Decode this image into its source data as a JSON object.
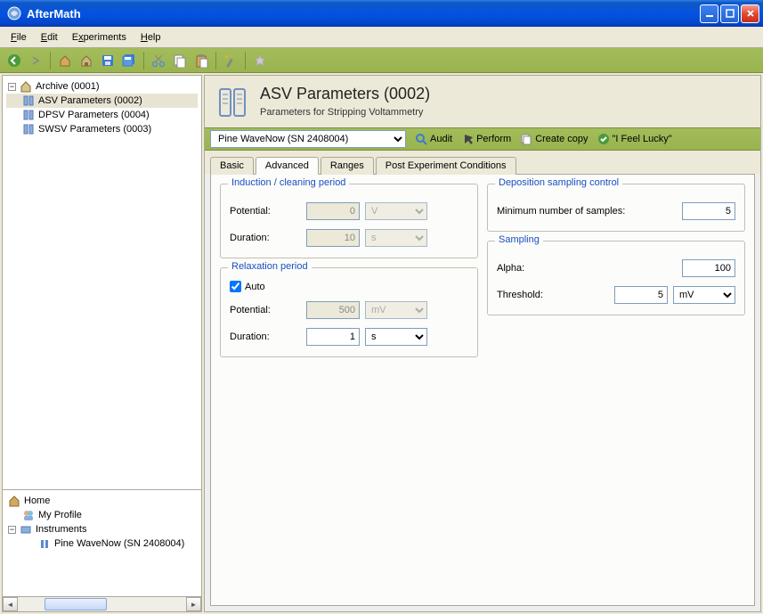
{
  "window": {
    "title": "AfterMath"
  },
  "menu": {
    "file": "File",
    "edit": "Edit",
    "experiments": "Experiments",
    "help": "Help"
  },
  "tree": {
    "archive": "Archive (0001)",
    "items": [
      "ASV Parameters (0002)",
      "DPSV Parameters (0004)",
      "SWSV Parameters (0003)"
    ]
  },
  "home": {
    "label": "Home",
    "profile": "My Profile",
    "instruments": "Instruments",
    "instrument_items": [
      "Pine WaveNow (SN 2408004)"
    ]
  },
  "header": {
    "title": "ASV Parameters (0002)",
    "subtitle": "Parameters for Stripping Voltammetry"
  },
  "instrument_bar": {
    "selected": "Pine WaveNow (SN 2408004)",
    "audit": "Audit",
    "perform": "Perform",
    "create_copy": "Create copy",
    "lucky": "\"I Feel Lucky\""
  },
  "tabs": {
    "basic": "Basic",
    "advanced": "Advanced",
    "ranges": "Ranges",
    "post": "Post Experiment Conditions"
  },
  "groups": {
    "induction": {
      "legend": "Induction / cleaning period",
      "potential_label": "Potential:",
      "potential_value": "0",
      "potential_unit": "V",
      "duration_label": "Duration:",
      "duration_value": "10",
      "duration_unit": "s"
    },
    "relaxation": {
      "legend": "Relaxation period",
      "auto_label": "Auto",
      "potential_label": "Potential:",
      "potential_value": "500",
      "potential_unit": "mV",
      "duration_label": "Duration:",
      "duration_value": "1",
      "duration_unit": "s"
    },
    "deposition": {
      "legend": "Deposition sampling control",
      "min_samples_label": "Minimum number of samples:",
      "min_samples_value": "5"
    },
    "sampling": {
      "legend": "Sampling",
      "alpha_label": "Alpha:",
      "alpha_value": "100",
      "threshold_label": "Threshold:",
      "threshold_value": "5",
      "threshold_unit": "mV"
    }
  }
}
